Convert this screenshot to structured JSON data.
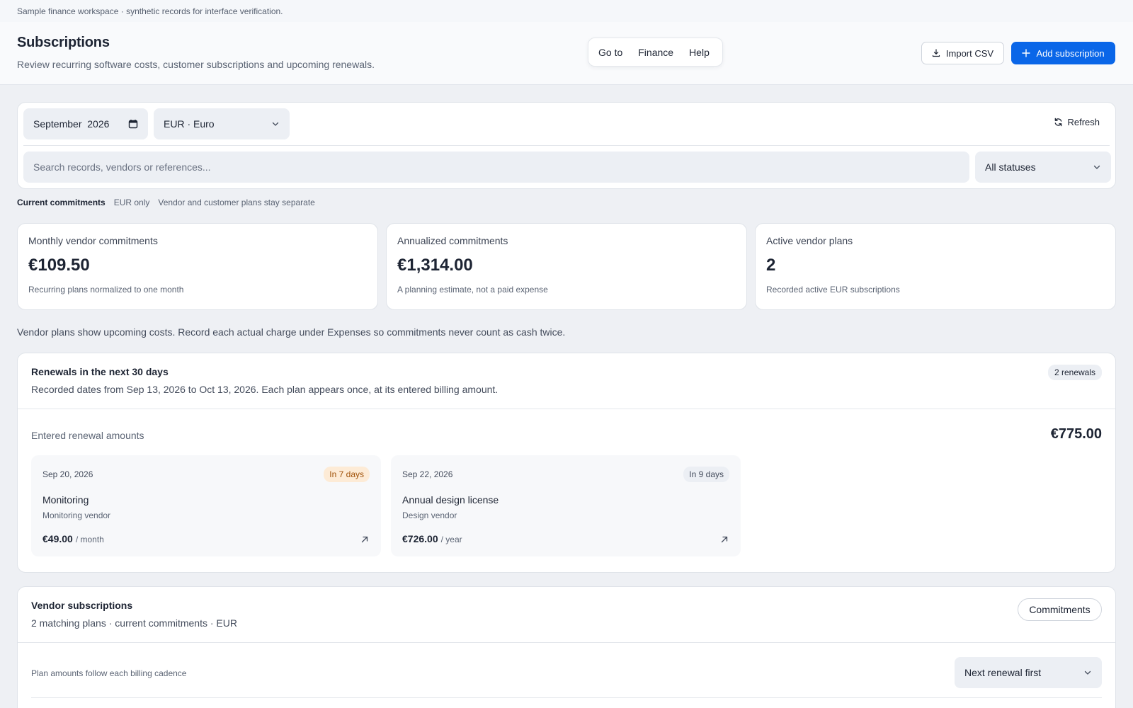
{
  "banner": "Sample finance workspace · synthetic records for interface verification.",
  "header": {
    "title": "Subscriptions",
    "subtitle": "Review recurring software costs, customer subscriptions and upcoming renewals.",
    "nav": [
      "Go to",
      "Finance",
      "Help"
    ],
    "import_label": "Import CSV",
    "add_label": "Add subscription"
  },
  "filters": {
    "month": "September",
    "year": "2026",
    "currency": "EUR · Euro",
    "refresh_label": "Refresh",
    "search_placeholder": "Search records, vendors or references...",
    "status": "All statuses"
  },
  "chips": [
    "Current commitments",
    "EUR only",
    "Vendor and customer plans stay separate"
  ],
  "kpis": [
    {
      "label": "Monthly vendor commitments",
      "value": "€109.50",
      "hint": "Recurring plans normalized to one month"
    },
    {
      "label": "Annualized commitments",
      "value": "€1,314.00",
      "hint": "A planning estimate, not a paid expense"
    },
    {
      "label": "Active vendor plans",
      "value": "2",
      "hint": "Recorded active EUR subscriptions"
    }
  ],
  "note": "Vendor plans show upcoming costs. Record each actual charge under Expenses so commitments never count as cash twice.",
  "renewals": {
    "title": "Renewals in the next 30 days",
    "subtitle": "Recorded dates from Sep 13, 2026 to Oct 13, 2026. Each plan appears once, at its entered billing amount.",
    "badge": "2 renewals",
    "amounts_label": "Entered renewal amounts",
    "total": "€775.00",
    "items": [
      {
        "date": "Sep 20, 2026",
        "due": "In 7 days",
        "name": "Monitoring",
        "vendor": "Monitoring vendor",
        "amount": "€49.00",
        "period": "/ month"
      },
      {
        "date": "Sep 22, 2026",
        "due": "In 9 days",
        "name": "Annual design license",
        "vendor": "Design vendor",
        "amount": "€726.00",
        "period": "/ year"
      }
    ]
  },
  "vendors": {
    "title": "Vendor subscriptions",
    "subtitle": "2 matching plans · current commitments · EUR",
    "toggle_label": "Commitments",
    "cadence_label": "Plan amounts follow each billing cadence",
    "sort": "Next renewal first"
  },
  "colors": {
    "accent": "#0a66e8",
    "warn_bg": "#fdebd6",
    "warn_text": "#a0520a"
  }
}
